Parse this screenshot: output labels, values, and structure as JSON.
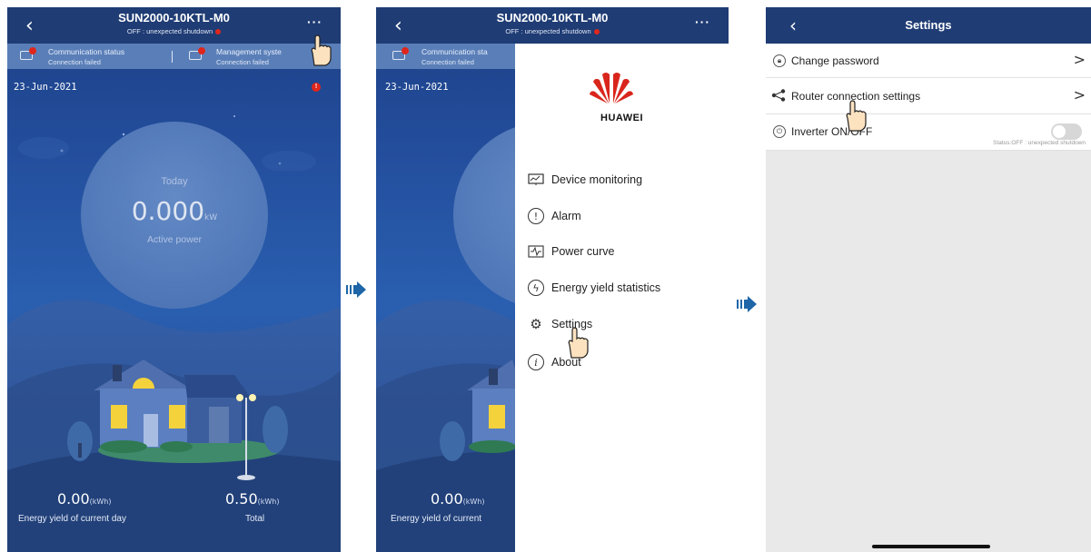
{
  "device": {
    "title": "SUN2000-10KTL-M0",
    "status_text": "OFF : unexpected shutdown",
    "more_label": "···",
    "back_label": "‹"
  },
  "status_bar": {
    "communication": {
      "label": "Communication status",
      "value": "Connection failed"
    },
    "management": {
      "label": "Management system",
      "value": "Connection failed"
    },
    "communication_short": "Communication sta",
    "management_short": "Management syste"
  },
  "home": {
    "date": "23-Jun-2021",
    "alarm_badge": "!",
    "today_label": "Today",
    "power_value": "0.000",
    "power_unit": "kW",
    "power_label": "Active power",
    "yield_day_value": "0.00",
    "yield_day_unit": "(kWh)",
    "yield_day_label": "Energy yield of current day",
    "yield_day_label_cut": "Energy yield of current",
    "total_value": "0.50",
    "total_unit": "(kWh)",
    "total_label": "Total",
    "obscured_power_glyph": "0"
  },
  "drawer": {
    "brand": "HUAWEI",
    "items": [
      {
        "label": "Device monitoring",
        "icon": "monitor-icon"
      },
      {
        "label": "Alarm",
        "icon": "alarm-icon"
      },
      {
        "label": "Power curve",
        "icon": "curve-icon"
      },
      {
        "label": "Energy yield statistics",
        "icon": "energy-icon"
      },
      {
        "label": "Settings",
        "icon": "gear-icon"
      },
      {
        "label": "About",
        "icon": "info-icon"
      }
    ]
  },
  "settings": {
    "title": "Settings",
    "rows": [
      {
        "label": "Change password",
        "icon": "lock-icon"
      },
      {
        "label": "Router connection settings",
        "icon": "share-icon"
      },
      {
        "label": "Inverter ON/OFF",
        "icon": "power-icon",
        "toggle_on": false
      }
    ],
    "inverter_status": "Status:OFF : unexpected shutdown"
  },
  "colors": {
    "topbar": "#1f3c74",
    "statusbar": "#5a7fb8",
    "alarm": "#e0261c",
    "huawei_red": "#d9261c",
    "flow_arrow": "#1e66a8"
  }
}
